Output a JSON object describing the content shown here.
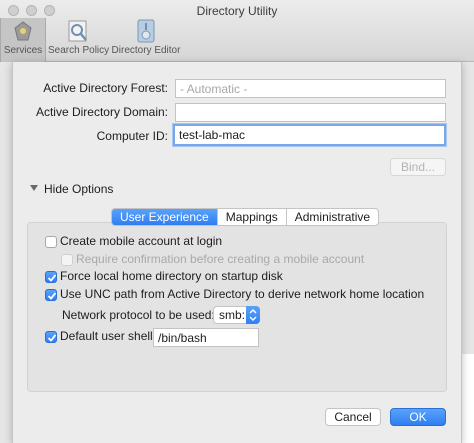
{
  "window": {
    "title": "Directory Utility"
  },
  "toolbar": {
    "items": [
      {
        "label": "Services",
        "icon": "services-icon",
        "active": true
      },
      {
        "label": "Search Policy",
        "icon": "search-policy-icon",
        "active": false
      },
      {
        "label": "Directory Editor",
        "icon": "directory-editor-icon",
        "active": false
      }
    ]
  },
  "form": {
    "forest_label": "Active Directory Forest:",
    "forest_placeholder": "- Automatic -",
    "domain_label": "Active Directory Domain:",
    "domain_value": "",
    "computer_id_label": "Computer ID:",
    "computer_id_value": "test-lab-mac",
    "bind_label": "Bind..."
  },
  "options": {
    "toggle_label": "Hide Options",
    "tabs": [
      {
        "label": "User Experience",
        "selected": true
      },
      {
        "label": "Mappings",
        "selected": false
      },
      {
        "label": "Administrative",
        "selected": false
      }
    ],
    "create_mobile": {
      "label": "Create mobile account at login",
      "checked": false
    },
    "require_confirmation": {
      "label": "Require confirmation before creating a mobile account",
      "checked": false,
      "enabled": false
    },
    "force_local": {
      "label": "Force local home directory on startup disk",
      "checked": true
    },
    "use_unc": {
      "label": "Use UNC path from Active Directory to derive network home location",
      "checked": true
    },
    "protocol_label": "Network protocol to be used:",
    "protocol_value": "smb:",
    "default_shell": {
      "label": "Default user shell:",
      "checked": true,
      "value": "/bin/bash"
    }
  },
  "footer": {
    "cancel_label": "Cancel",
    "ok_label": "OK"
  },
  "colors": {
    "accent": "#2f7ff3",
    "focus_ring": "#7aa7e8",
    "panel": "#e3e3e3",
    "dialog": "#ececec"
  }
}
